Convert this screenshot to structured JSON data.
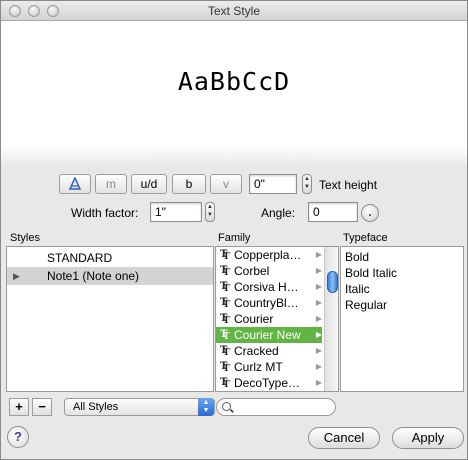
{
  "window": {
    "title": "Text Style"
  },
  "preview": {
    "sample_text": "AaBbCcD",
    "ghost_text": "Courier New - Regular - 0.0"
  },
  "toolbar": {
    "buttons": [
      {
        "name": "annotative-button",
        "label": "",
        "icon": "annotative-icon"
      },
      {
        "name": "mirror-button",
        "label": "m"
      },
      {
        "name": "upside-down-button",
        "label": "u/d"
      },
      {
        "name": "backwards-button",
        "label": "b"
      },
      {
        "name": "vertical-button",
        "label": "v"
      }
    ],
    "text_height": {
      "value": "0\"",
      "label": "Text height"
    },
    "width_factor": {
      "label": "Width factor:",
      "value": "1\""
    },
    "angle": {
      "label": "Angle:",
      "value": "0"
    }
  },
  "styles": {
    "header": "Styles",
    "items": [
      {
        "label": "STANDARD",
        "selected": false,
        "disclosure": ""
      },
      {
        "label": "Note1 (Note one)",
        "selected": true,
        "disclosure": "▶"
      }
    ],
    "filter": {
      "value": "All Styles"
    },
    "add_label": "+",
    "remove_label": "−"
  },
  "family": {
    "header": "Family",
    "items": [
      {
        "label": "Copperpla…",
        "selected": false
      },
      {
        "label": "Corbel",
        "selected": false
      },
      {
        "label": "Corsiva H…",
        "selected": false
      },
      {
        "label": "CountryBl…",
        "selected": false
      },
      {
        "label": "Courier",
        "selected": false
      },
      {
        "label": "Courier New",
        "selected": true
      },
      {
        "label": "Cracked",
        "selected": false
      },
      {
        "label": "Curlz MT",
        "selected": false
      },
      {
        "label": "DecoType…",
        "selected": false
      }
    ],
    "arrow": "▶"
  },
  "typeface": {
    "header": "Typeface",
    "items": [
      "Bold",
      "Bold Italic",
      "Italic",
      "Regular"
    ]
  },
  "search": {
    "placeholder": ""
  },
  "footer": {
    "help_label": "?",
    "cancel_label": "Cancel",
    "apply_label": "Apply"
  }
}
